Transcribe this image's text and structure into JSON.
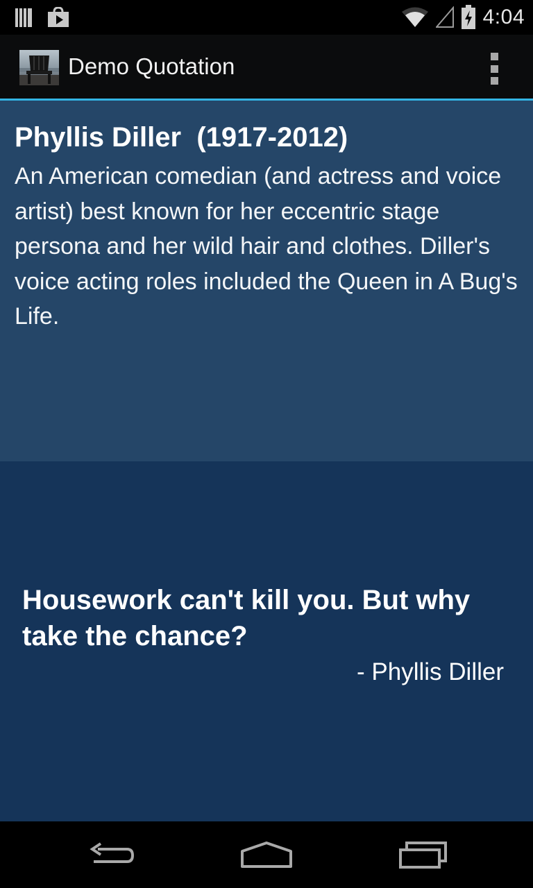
{
  "status_bar": {
    "time": "4:04",
    "left_icons": [
      "library-icon",
      "play-store-icon"
    ],
    "right_icons": [
      "wifi-icon",
      "signal-icon",
      "battery-charging-icon"
    ]
  },
  "action_bar": {
    "title": "Demo Quotation",
    "app_icon": "chair-photo-app-icon",
    "menu_icon": "overflow-menu-icon"
  },
  "bio": {
    "name": "Phyllis Diller  (1917-2012)",
    "description": "An American comedian (and actress and voice artist) best known for her eccentric stage persona and her wild hair and clothes. Diller's voice acting roles included the Queen in A Bug's Life."
  },
  "quote": {
    "text": "Housework can't kill you. But why take the chance?",
    "author": "- Phyllis Diller"
  },
  "nav_bar": {
    "buttons": [
      "back-icon",
      "home-icon",
      "recent-apps-icon"
    ]
  },
  "colors": {
    "bio_background": "#254668",
    "quote_background": "#153459",
    "action_bar_accent": "#33b5e5"
  }
}
